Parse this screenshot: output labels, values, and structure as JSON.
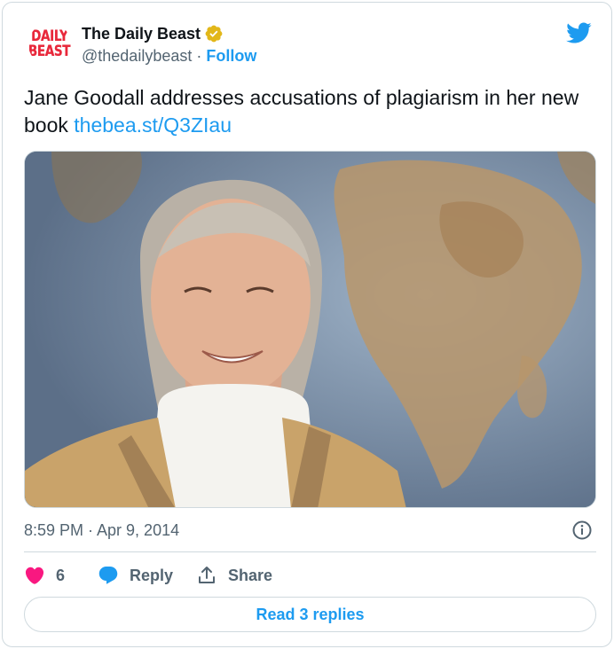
{
  "author": {
    "avatar_line1": "DAILY",
    "avatar_line2": "BEAST",
    "name": "The Daily Beast",
    "handle": "@thedailybeast",
    "separator": "·",
    "follow_label": "Follow"
  },
  "tweet": {
    "text": "Jane Goodall addresses accusations of plagiarism in her new book ",
    "link": "thebea.st/Q3ZIau"
  },
  "meta": {
    "timestamp": "8:59 PM · Apr 9, 2014"
  },
  "actions": {
    "like_count": "6",
    "reply_label": "Reply",
    "share_label": "Share"
  },
  "read_replies_label": "Read 3 replies",
  "colors": {
    "accent": "#1d9bf0",
    "like": "#f91880",
    "verified": "#e2b719",
    "brand_red": "#e8283b"
  },
  "icons": {
    "verified": "verified-badge-icon",
    "platform": "twitter-bird-icon",
    "info": "info-icon",
    "like": "heart-icon",
    "reply": "speech-bubble-icon",
    "share": "share-upload-icon"
  }
}
